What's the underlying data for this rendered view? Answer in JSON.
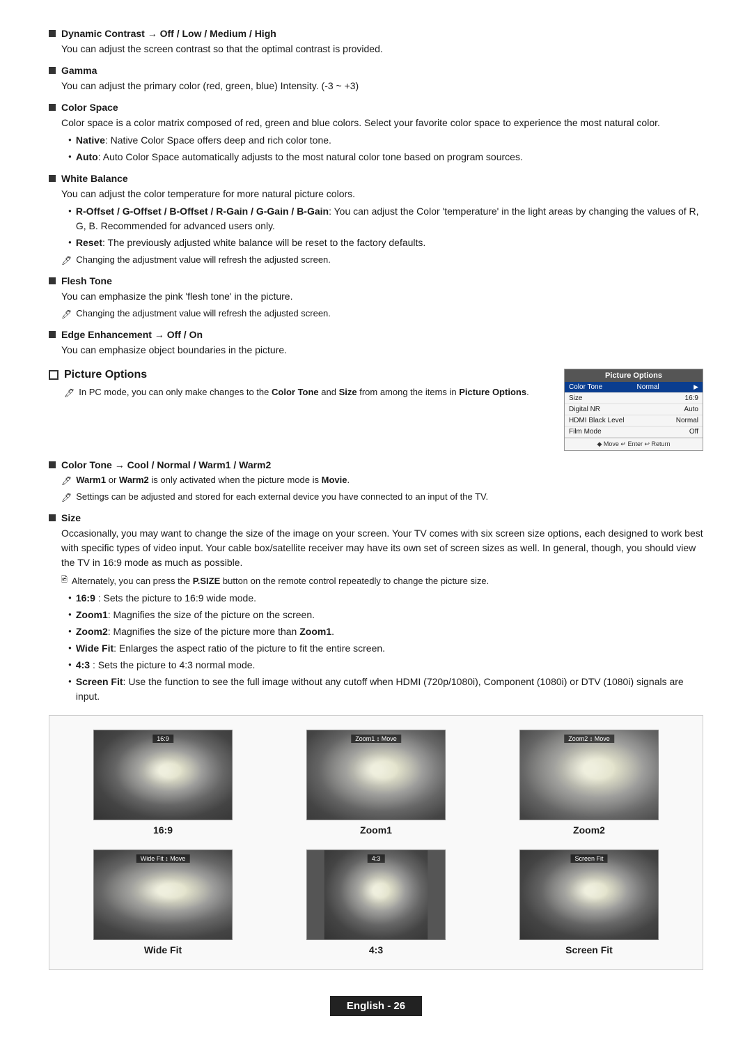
{
  "sections": [
    {
      "id": "dynamic-contrast",
      "title": "Dynamic Contrast → Off / Low / Medium / High",
      "body": "You can adjust the screen contrast so that the optimal contrast is provided."
    },
    {
      "id": "gamma",
      "title": "Gamma",
      "body": "You can adjust the primary color (red, green, blue) Intensity. (-3 ~ +3)"
    },
    {
      "id": "color-space",
      "title": "Color Space",
      "body": "Color space is a color matrix composed of red, green and blue colors. Select your favorite color space to experience the most natural color.",
      "bullets": [
        {
          "label": "Native",
          "text": ": Native Color Space offers deep and rich color tone."
        },
        {
          "label": "Auto",
          "text": ": Auto Color Space automatically adjusts to the most natural color tone based on program sources."
        }
      ]
    },
    {
      "id": "white-balance",
      "title": "White Balance",
      "body": "You can adjust the color temperature for more natural picture colors.",
      "bullets": [
        {
          "label": "R-Offset / G-Offset / B-Offset / R-Gain / G-Gain / B-Gain",
          "text": ": You can adjust the Color 'temperature' in the light areas by changing the values of R, G, B. Recommended for advanced users only."
        },
        {
          "label": "Reset",
          "text": ": The previously adjusted white balance will be reset to the factory defaults."
        }
      ],
      "notes": [
        "Changing the adjustment value will refresh the adjusted screen."
      ]
    },
    {
      "id": "flesh-tone",
      "title": "Flesh Tone",
      "body": "You can emphasize the pink 'flesh tone' in the picture.",
      "notes": [
        "Changing the adjustment value will refresh the adjusted screen."
      ]
    },
    {
      "id": "edge-enhancement",
      "title": "Edge Enhancement → Off / On",
      "body": "You can emphasize object boundaries in the picture."
    }
  ],
  "picture_options": {
    "section_title": "Picture Options",
    "intro_note": "In PC mode, you can only make changes to the Color Tone and Size from among the items in Picture Options.",
    "color_tone_section": {
      "title": "Color Tone → Cool / Normal / Warm1 / Warm2",
      "notes": [
        "Warm1 or Warm2 is only activated when the picture mode is Movie.",
        "Settings can be adjusted and stored for each external device you have connected to an input of the TV."
      ]
    },
    "size_section": {
      "title": "Size",
      "body": "Occasionally, you may want to change the size of the image on your screen. Your TV comes with six screen size options, each designed to work best with specific types of video input. Your cable box/satellite receiver may have its own set of screen sizes as well. In general, though, you should view the TV in 16:9 mode as much as possible.",
      "note": "Alternately, you can press the P.SIZE button on the remote control repeatedly to change the picture size.",
      "bullets": [
        {
          "label": "16:9",
          "text": " : Sets the picture to 16:9 wide mode."
        },
        {
          "label": "Zoom1",
          "text": ": Magnifies the size of the picture on the screen."
        },
        {
          "label": "Zoom2",
          "text": ": Magnifies the size of the picture more than Zoom1."
        },
        {
          "label": "Wide Fit",
          "text": ": Enlarges the aspect ratio of the picture to fit the entire screen."
        },
        {
          "label": "4:3",
          "text": " : Sets the picture to 4:3 normal mode."
        },
        {
          "label": "Screen Fit",
          "text": ": Use the function to see the full image without any cutoff when HDMI (720p/1080i), Component (1080i) or DTV (1080i) signals are input."
        }
      ]
    }
  },
  "osd_table": {
    "title": "Picture Options",
    "rows": [
      {
        "label": "Color Tone",
        "value": "Normal",
        "highlighted": true
      },
      {
        "label": "Size",
        "value": "16:9",
        "highlighted": false
      },
      {
        "label": "Digital NR",
        "value": "Auto",
        "highlighted": false
      },
      {
        "label": "HDMI Black Level",
        "value": "Normal",
        "highlighted": false
      },
      {
        "label": "Film Mode",
        "value": "Off",
        "highlighted": false
      }
    ],
    "nav": "◆ Move  ↵ Enter  ↩ Return"
  },
  "image_grid": {
    "row1": [
      {
        "label": "16:9",
        "caption": "16:9",
        "bar_text": "16:9",
        "has_arrow": false
      },
      {
        "label": "Zoom1",
        "caption": "Zoom1",
        "bar_text": "Zoom1 ↕ Move",
        "has_arrow": true
      },
      {
        "label": "Zoom2",
        "caption": "Zoom2",
        "bar_text": "Zoom2 ↕ Move",
        "has_arrow": true
      }
    ],
    "row2": [
      {
        "label": "Wide Fit",
        "caption": "Wide Fit",
        "bar_text": "Wide Fit ↕ Move",
        "has_arrow": true
      },
      {
        "label": "4:3",
        "caption": "4:3",
        "bar_text": "4:3",
        "has_arrow": false
      },
      {
        "label": "Screen Fit",
        "caption": "Screen Fit",
        "bar_text": "Screen Fit",
        "has_arrow": false
      }
    ]
  },
  "footer": {
    "text": "English - 26"
  }
}
